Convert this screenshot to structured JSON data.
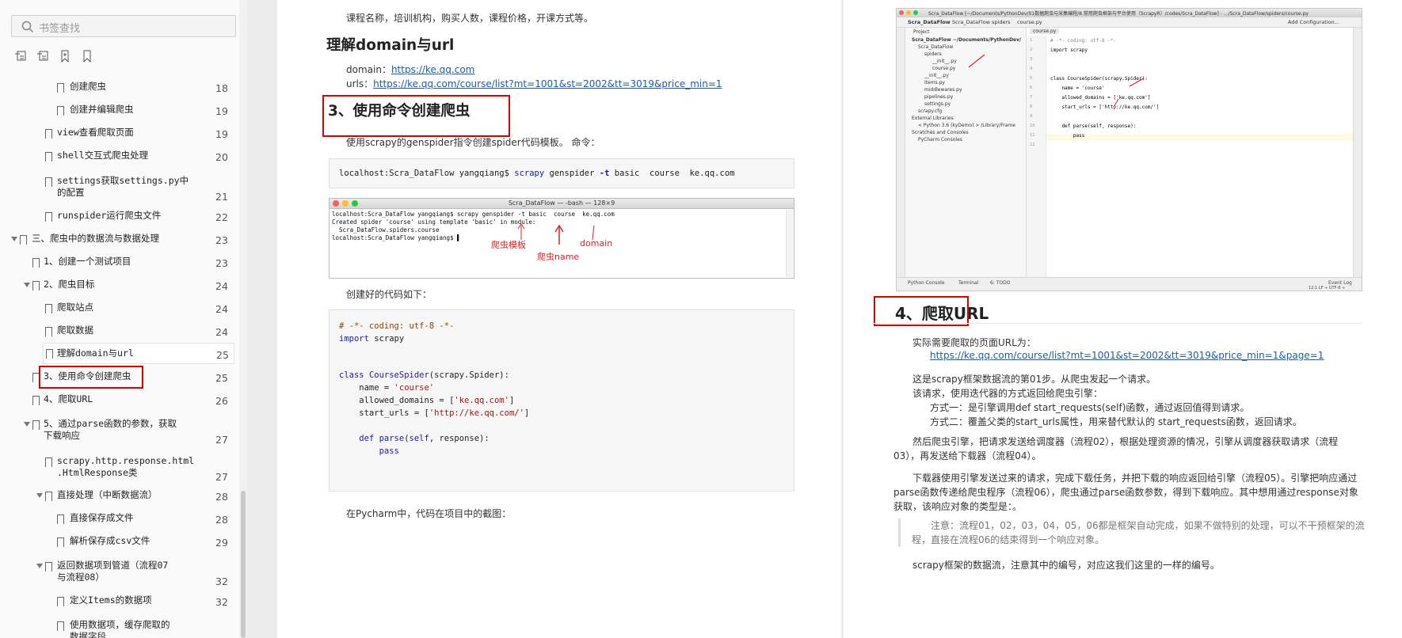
{
  "sidebar": {
    "search_placeholder": "书签查找",
    "toolbar_icons": [
      "expand-all-icon",
      "collapse-all-icon",
      "add-bookmark-icon",
      "bookmark-icon"
    ],
    "toc": [
      {
        "label": "创建爬虫",
        "page": "18",
        "level": 3
      },
      {
        "label": "创建并编辑爬虫",
        "page": "19",
        "level": 3
      },
      {
        "label": "view查看爬取页面",
        "page": "19",
        "level": 2
      },
      {
        "label": "shell交互式爬虫处理",
        "page": "20",
        "level": 2
      },
      {
        "label": "settings获取settings.py中\n的配置",
        "page": "21",
        "level": 2
      },
      {
        "label": "runspider运行爬虫文件",
        "page": "22",
        "level": 2
      },
      {
        "label": "三、爬虫中的数据流与数据处理",
        "page": "23",
        "level": 0,
        "expanded": true
      },
      {
        "label": "1、创建一个测试项目",
        "page": "23",
        "level": 1
      },
      {
        "label": "2、爬虫目标",
        "page": "24",
        "level": 1,
        "expanded": true
      },
      {
        "label": "爬取站点",
        "page": "24",
        "level": 2
      },
      {
        "label": "爬取数据",
        "page": "24",
        "level": 2
      },
      {
        "label": "理解domain与url",
        "page": "25",
        "level": 2,
        "selected": true
      },
      {
        "label": "3、使用命令创建爬虫",
        "page": "25",
        "level": 1,
        "highlighted": true
      },
      {
        "label": "4、爬取URL",
        "page": "26",
        "level": 1
      },
      {
        "label": "5、通过parse函数的参数，获取\n下载响应",
        "page": "27",
        "level": 1,
        "expanded": true
      },
      {
        "label": "scrapy.http.response.html\n.HtmlResponse类",
        "page": "27",
        "level": 2
      },
      {
        "label": "直接处理（中断数据流）",
        "page": "28",
        "level": 2,
        "expanded": true
      },
      {
        "label": "直接保存成文件",
        "page": "28",
        "level": 3
      },
      {
        "label": "解析保存成csv文件",
        "page": "29",
        "level": 3
      },
      {
        "label": "返回数据项到管道（流程07\n与流程08）",
        "page": "32",
        "level": 2,
        "expanded": true
      },
      {
        "label": "定义Items的数据项",
        "page": "32",
        "level": 3
      },
      {
        "label": "使用数据项，缓存爬取的\n数据字段",
        "page": "",
        "level": 3
      }
    ]
  },
  "page1": {
    "intro": "课程名称，培训机构，购买人数，课程价格，开课方式等。",
    "heading_domain": "理解domain与url",
    "domain_label": "domain：",
    "domain_value": "https://ke.qq.com",
    "urls_label": "urls：",
    "urls_value": "https://ke.qq.com/course/list?mt=1001&st=2002&tt=3019&price_min=1",
    "heading_cmd": "3、使用命令创建爬虫",
    "cmd_desc": "使用scrapy的genspider指令创建spider代码模板。      命令：",
    "cmd_prompt": "localhost:Scra_DataFlow yangqiang$",
    "cmd_scrapy": "scrapy",
    "cmd_rest1": "genspider",
    "cmd_flag": "-t",
    "cmd_rest2": "basic  course  ke.qq.com",
    "terminal": {
      "title": "Scra_DataFlow — -bash — 128×9",
      "lines": [
        "localhost:Scra_DataFlow yangqiang$ scrapy genspider -t basic  course  ke.qq.com",
        "Created spider 'course' using template 'basic' in module:",
        "  Scra_DataFlow.spiders.course",
        "localhost:Scra_DataFlow yangqiang$ ▌"
      ],
      "annotations": [
        "爬虫模板",
        "爬虫name",
        "domain"
      ]
    },
    "code_intro": "创建好的代码如下：",
    "code": {
      "l1": "# -*- coding: utf-8 -*-",
      "l2a": "import",
      "l2b": " scrapy",
      "l3a": "class ",
      "l3b": "CourseSpider",
      "l3c": "(scrapy.Spider):",
      "l4a": "    name = ",
      "l4b": "'course'",
      "l5a": "    allowed_domains = [",
      "l5b": "'ke.qq.com'",
      "l5c": "]",
      "l6a": "    start_urls = [",
      "l6b": "'http://ke.qq.com/'",
      "l6c": "]",
      "l7a": "    def ",
      "l7b": "parse",
      "l7c": "(",
      "l7d": "self",
      "l7e": ", response):",
      "l8": "        pass"
    },
    "pycharm_intro": "在Pycharm中，代码在项目中的截图："
  },
  "page2": {
    "ide": {
      "title": "Scra_DataFlow [~/Documents/PythonDev/01数据爬虫与采集编程/8.常用爬虫框架与平台使用（ScrapyR）/codes/Scra_DataFlow] - .../Scra_DataFlow/spiders/course.py",
      "nav": [
        "Scra_DataFlow",
        "Scra_DataFlow",
        "spiders",
        "course.py"
      ],
      "project_label": "Project",
      "tree": [
        "Scra_DataFlow  ~/Documents/PythonDev/",
        "Scra_DataFlow",
        "spiders",
        "__init__.py",
        "course.py",
        "__init__.py",
        "items.py",
        "middlewares.py",
        "pipelines.py",
        "settings.py",
        "scrapy.cfg",
        "External Libraries",
        "< Python 3.6 (kyDemo) >  /Library/Frame",
        "Scratches and Consoles",
        "PyCharm Consoles"
      ],
      "tab": "course.py",
      "code": [
        "# -*- coding: utf-8 -*-",
        "import scrapy",
        "",
        "",
        "class CourseSpider(scrapy.Spider):",
        "    name = 'course'",
        "    allowed_domains = ['ke.qq.com']",
        "    start_urls = ['http://ke.qq.com/']",
        "",
        "    def parse(self, response):",
        "        pass",
        ""
      ],
      "bottom_tabs": [
        "Python Console",
        "Terminal",
        "6: TODO"
      ],
      "event_log": "Event Log",
      "status": "12:1  LF ÷  UTF-8 ÷",
      "add_config": "Add Configuration..."
    },
    "heading": "4、爬取URL",
    "url_intro": "实际需要爬取的页面URL为：",
    "url": "https://ke.qq.com/course/list?mt=1001&st=2002&tt=3019&price_min=1&page=1",
    "p1": "这是scrapy框架数据流的第01步。从爬虫发起一个请求。",
    "p2": "该请求，使用迭代器的方式返回给爬虫引擎：",
    "p3": "方式一：是引擎调用def start_requests(self)函数，通过返回值得到请求。",
    "p4": "方式二：覆盖父类的start_urls属性，用来替代默认的 start_requests函数，返回请求。",
    "p5": "然后爬虫引擎，把请求发送给调度器（流程02），根据处理资源的情况，引擎从调度器获取请求（流程03），再发送给下载器（流程04）。",
    "p6": "下载器使用引擎发送过来的请求，完成下载任务，并把下载的响应返回给引擎（流程05）。引擎把响应通过parse函数传递给爬虫程序（流程06），爬虫通过parse函数参数，得到下载响应。其中想用通过response对象获取，该响应对象的类型是：。",
    "note": "注意：流程01，02，03，04，05，06都是框架自动完成，如果不做特别的处理，可以不干预框架的流程，直接在流程06的结束得到一个响应对象。",
    "p7": "scrapy框架的数据流，注意其中的编号，对应这我们这里的一样的编号。"
  }
}
